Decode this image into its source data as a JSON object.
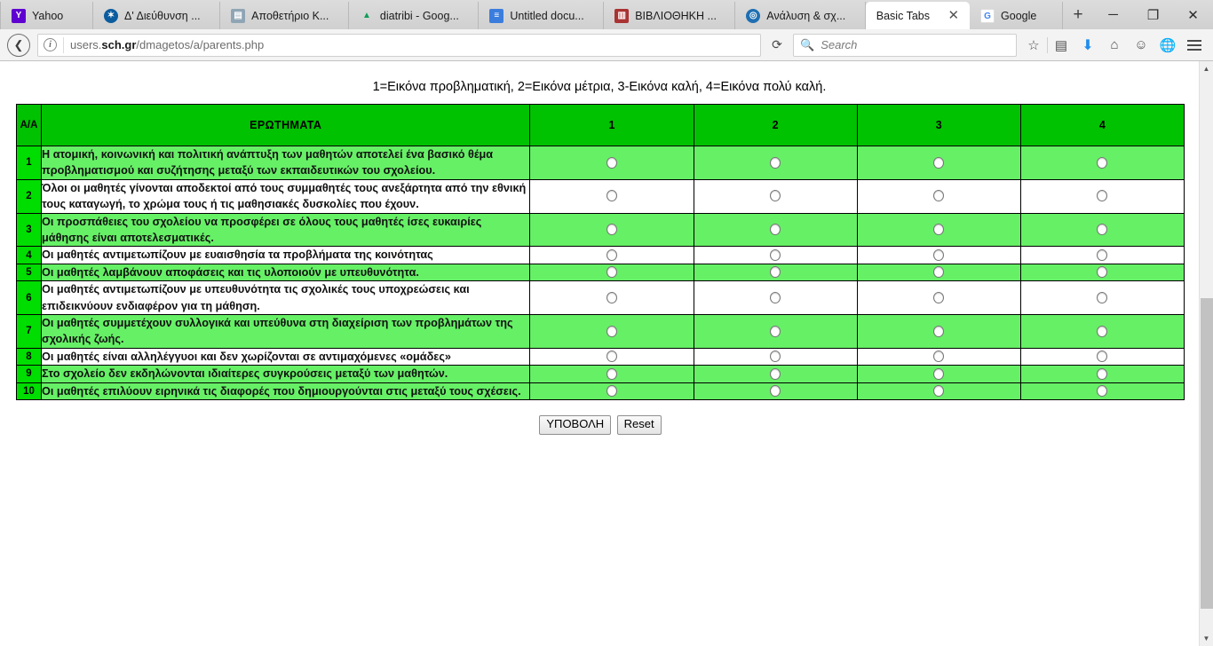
{
  "browser": {
    "tabs": [
      {
        "label": "Yahoo",
        "favicon": "yahoo-icon",
        "active": false
      },
      {
        "label": "Δ' Διεύθυνση ...",
        "favicon": "directorate-icon",
        "active": false
      },
      {
        "label": "Αποθετήριο Κ...",
        "favicon": "repository-icon",
        "active": false
      },
      {
        "label": "diatribi - Goog...",
        "favicon": "google-drive-icon",
        "active": false
      },
      {
        "label": "Untitled docu...",
        "favicon": "google-docs-icon",
        "active": false
      },
      {
        "label": "ΒΙΒΛΙΟΘΗΚΗ ...",
        "favicon": "library-icon",
        "active": false
      },
      {
        "label": "Ανάλυση & σχ...",
        "favicon": "analysis-icon",
        "active": false
      },
      {
        "label": "Basic Tabs",
        "favicon": "",
        "active": true
      },
      {
        "label": "Google",
        "favicon": "google-icon",
        "active": false
      }
    ],
    "new_tab_label": "+",
    "window_controls": {
      "minimize": "─",
      "maximize": "❐",
      "close": "✕"
    },
    "nav": {
      "back_label": "←",
      "reload_label": "⟳",
      "url_prefix": "users.",
      "url_host": "sch.gr",
      "url_path": "/dmagetos/a/parents.php",
      "url_full": "users.sch.gr/dmagetos/a/parents.php"
    },
    "search": {
      "placeholder": "Search",
      "icon": "search-icon"
    },
    "toolbar_icons": [
      {
        "name": "bookmark-star-icon",
        "glyph": "☆"
      },
      {
        "name": "library-icon",
        "glyph": "Ὄb"
      },
      {
        "name": "downloads-icon",
        "glyph": "⬇"
      },
      {
        "name": "home-icon",
        "glyph": "⌂"
      },
      {
        "name": "sync-account-icon",
        "glyph": "☺"
      },
      {
        "name": "pocket-icon",
        "glyph": "ἱ0"
      },
      {
        "name": "menu-icon",
        "glyph": "☰"
      }
    ]
  },
  "page": {
    "legend": "1=Εικόνα προβληματική, 2=Εικόνα μέτρια, 3-Εικόνα καλή, 4=Εικόνα πολύ καλή.",
    "table": {
      "headers": {
        "index": "Α/Α",
        "question": "ΕΡΩΤΗΜΑΤΑ",
        "options": [
          "1",
          "2",
          "3",
          "4"
        ]
      },
      "rows": [
        {
          "n": "1",
          "text": "Η ατομική, κοινωνική και πολιτική ανάπτυξη των μαθητών αποτελεί ένα βασικό θέμα προβληματισμού και συζήτησης μεταξύ των εκπαιδευτικών του σχολείου."
        },
        {
          "n": "2",
          "text": " Όλοι οι μαθητές γίνονται αποδεκτοί από τους συμμαθητές τους ανεξάρτητα από την εθνική τους καταγωγή, το χρώμα τους ή τις μαθησιακές δυσκολίες που έχουν."
        },
        {
          "n": "3",
          "text": " Οι προσπάθειες του σχολείου να προσφέρει σε όλους τους μαθητές ίσες ευκαιρίες μάθησης είναι αποτελεσματικές."
        },
        {
          "n": "4",
          "text": "Οι μαθητές αντιμετωπίζουν με ευαισθησία τα προβλήματα της κοινότητας"
        },
        {
          "n": "5",
          "text": "Οι μαθητές λαμβάνουν αποφάσεις και τις υλοποιούν με υπευθυνότητα."
        },
        {
          "n": "6",
          "text": "Οι μαθητές αντιμετωπίζουν με υπευθυνότητα τις σχολικές τους υποχρεώσεις και επιδεικνύουν ενδιαφέρον για τη μάθηση."
        },
        {
          "n": "7",
          "text": "Οι μαθητές συμμετέχουν συλλογικά και υπεύθυνα στη διαχείριση των προβλημάτων της σχολικής ζωής."
        },
        {
          "n": "8",
          "text": "Οι μαθητές είναι αλληλέγγυοι και δεν χωρίζονται σε αντιμαχόμενες «ομάδες»"
        },
        {
          "n": "9",
          "text": "Στο σχολείο δεν εκδηλώνονται ιδιαίτερες συγκρούσεις μεταξύ των μαθητών."
        },
        {
          "n": "10",
          "text": "Οι μαθητές επιλύουν ειρηνικά τις διαφορές που δημιουργούνται στις μεταξύ τους σχέσεις."
        }
      ]
    },
    "buttons": {
      "submit": "ΥΠΟΒΟΛΗ",
      "reset": "Reset"
    }
  },
  "colors": {
    "header_green": "#00c200",
    "index_green": "#00dd00",
    "row_light_green": "#66f066",
    "row_white": "#ffffff",
    "download_blue": "#1f8ded"
  }
}
